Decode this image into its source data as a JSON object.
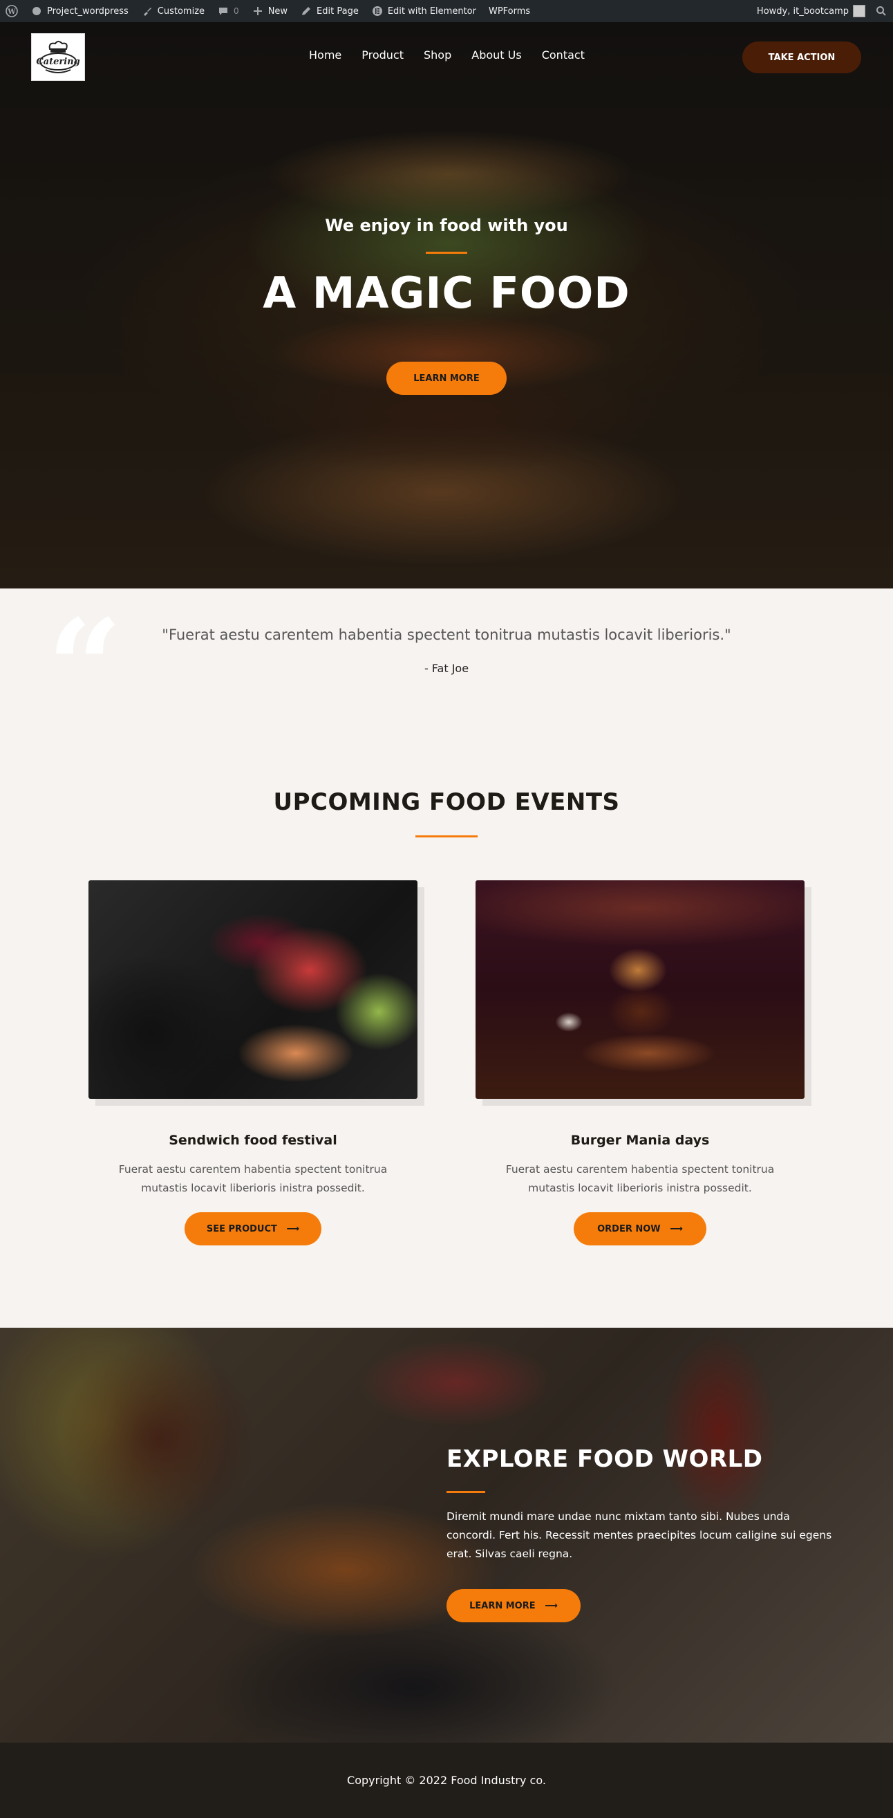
{
  "admin_bar": {
    "site_name": "Project_wordpress",
    "customize": "Customize",
    "comments_count": "0",
    "new": "New",
    "edit_page": "Edit Page",
    "edit_elementor": "Edit with Elementor",
    "wpforms": "WPForms",
    "howdy": "Howdy, it_bootcamp"
  },
  "header": {
    "logo_text": "Catering",
    "nav": [
      "Home",
      "Product",
      "Shop",
      "About Us",
      "Contact"
    ],
    "cta": "TAKE ACTION"
  },
  "hero": {
    "subtitle": "We enjoy in food with you",
    "title": "A MAGIC FOOD",
    "button": "LEARN MORE"
  },
  "quote": {
    "text": "\"Fuerat aestu carentem habentia spectent tonitrua mutastis locavit liberioris.\"",
    "author": "- Fat Joe"
  },
  "events": {
    "title": "UPCOMING FOOD EVENTS",
    "cards": [
      {
        "title": "Sendwich food festival",
        "desc": "Fuerat aestu carentem habentia spectent tonitrua mutastis locavit liberioris inistra possedit.",
        "button": "SEE PRODUCT"
      },
      {
        "title": "Burger Mania days",
        "desc": "Fuerat aestu carentem habentia spectent tonitrua mutastis locavit liberioris inistra possedit.",
        "button": "ORDER NOW"
      }
    ]
  },
  "explore": {
    "title": "EXPLORE FOOD WORLD",
    "text": "Diremit mundi mare undae nunc mixtam tanto sibi. Nubes unda concordi. Fert his. Recessit mentes praecipites locum caligine sui egens erat. Silvas caeli regna.",
    "button": "LEARN MORE"
  },
  "footer": {
    "copyright": "Copyright © 2022 Food Industry co."
  },
  "colors": {
    "accent": "#f57c0b",
    "dark_button": "#4a1d06",
    "footer_bg": "#211d19",
    "page_bg": "#f7f3f0"
  }
}
